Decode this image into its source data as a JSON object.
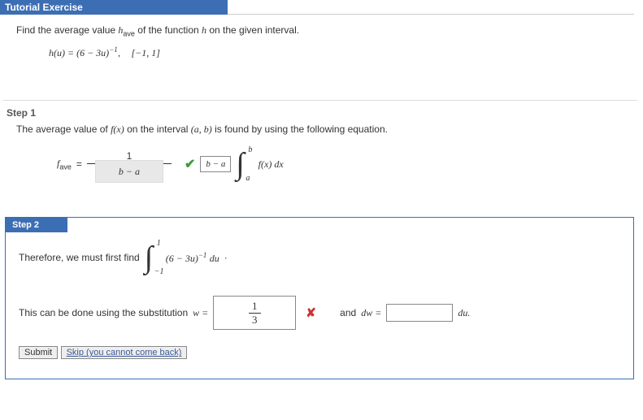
{
  "header": {
    "title": "Tutorial Exercise"
  },
  "problem": {
    "prompt_pre": "Find the average value ",
    "prompt_sym": "h",
    "prompt_sub": "ave",
    "prompt_mid": " of the function ",
    "prompt_fn": "h",
    "prompt_post": " on the given interval.",
    "eq_lhs": "h(u) = (6 − 3u)",
    "eq_exp": "−1",
    "eq_sep": ",",
    "interval": "[−1, 1]"
  },
  "step1": {
    "label": "Step 1",
    "text_pre": "The average value of ",
    "fx": "f(x)",
    "text_mid": " on the interval ",
    "ab": "(a, b)",
    "text_post": " is found by using the following equation.",
    "fave": "f",
    "fave_sub": "ave",
    "equals": " = ",
    "num": "1",
    "den_answer": "b − a",
    "boxed_answer": "b − a",
    "int_upper": "b",
    "int_lower": "a",
    "integrand": "f(x) dx"
  },
  "step2": {
    "label": "Step 2",
    "line1_pre": "Therefore, we must first find ",
    "int_upper": "1",
    "int_lower": "−1",
    "integrand_a": "(6 − 3u)",
    "integrand_exp": "−1",
    "integrand_du": " du",
    "dot": "·",
    "line2_pre": "This can be done using the substitution  ",
    "w_eq": "w =",
    "box1_num": "1",
    "box1_den": "3",
    "line2_mid": "and  ",
    "dw_eq": "dw =",
    "du_label": "du.",
    "submit": "Submit",
    "skip": "Skip (you cannot come back)"
  },
  "icons": {
    "check": "✔",
    "cross": "✘"
  }
}
